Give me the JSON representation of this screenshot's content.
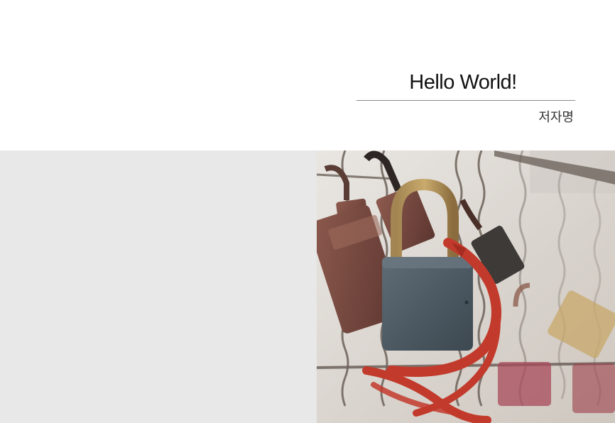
{
  "cover": {
    "title": "Hello World!",
    "author": "저자명"
  },
  "photo": {
    "subject": "padlocks on a wire fence with a red ribbon",
    "colors": {
      "background": "#d9d4cf",
      "main_lock": "#4f5c66",
      "ribbon": "#c23a2b",
      "wire": "#6c625a"
    }
  }
}
